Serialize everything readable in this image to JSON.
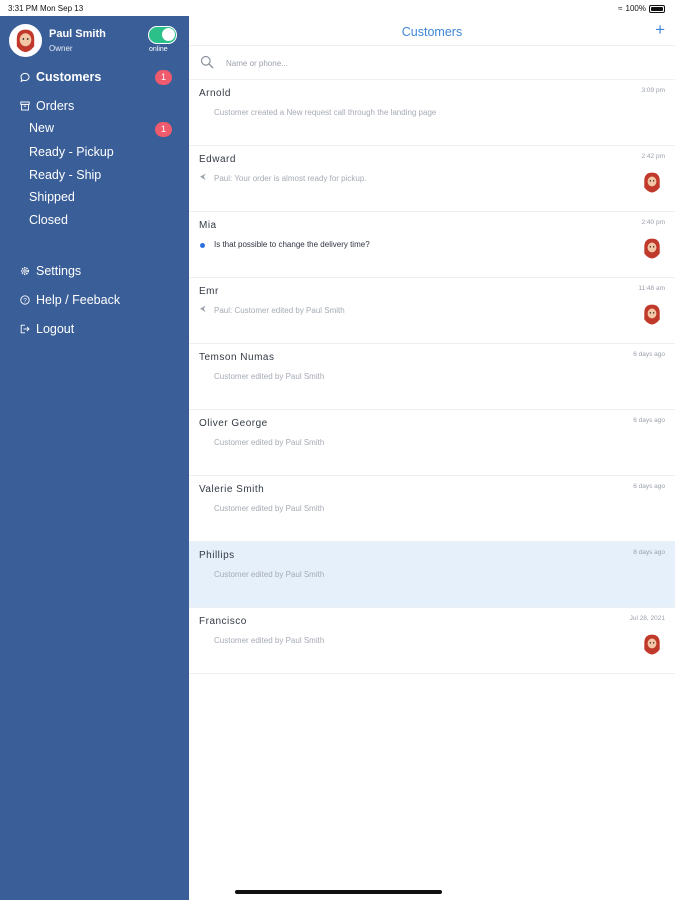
{
  "status_bar": {
    "time_date": "3:31 PM  Mon Sep 13",
    "battery": "100%"
  },
  "profile": {
    "name": "Paul Smith",
    "role": "Owner",
    "status": "online"
  },
  "nav": {
    "customers": {
      "label": "Customers",
      "badge": "1"
    },
    "orders": {
      "label": "Orders"
    },
    "order_subitems": [
      {
        "label": "New",
        "badge": "1"
      },
      {
        "label": "Ready - Pickup"
      },
      {
        "label": "Ready - Ship"
      },
      {
        "label": "Shipped"
      },
      {
        "label": "Closed"
      }
    ],
    "settings": {
      "label": "Settings"
    },
    "help": {
      "label": "Help / Feeback"
    },
    "logout": {
      "label": "Logout"
    }
  },
  "header": {
    "title": "Customers",
    "add_icon": "+"
  },
  "search": {
    "placeholder": "Name or phone..."
  },
  "customers": [
    {
      "name": "Arnold",
      "time": "3:09 pm",
      "message": "Customer created a New request call through the landing page",
      "marker": "none",
      "avatar": false,
      "selected": false
    },
    {
      "name": "Edward",
      "time": "2:42 pm",
      "message": "Paul: Your order is almost ready for pickup.",
      "marker": "reply",
      "avatar": true,
      "selected": false
    },
    {
      "name": "Mia",
      "time": "2:40 pm",
      "message": "Is that possible to change the delivery time?",
      "marker": "unread",
      "avatar": true,
      "selected": false
    },
    {
      "name": "Emr",
      "time": "11:48 am",
      "message": "Paul: Customer edited by Paul Smith",
      "marker": "reply",
      "avatar": true,
      "selected": false
    },
    {
      "name": "Temson Numas",
      "time": "6 days ago",
      "message": "Customer edited by Paul Smith",
      "marker": "none",
      "avatar": false,
      "selected": false
    },
    {
      "name": "Oliver George",
      "time": "6 days ago",
      "message": "Customer edited by Paul Smith",
      "marker": "none",
      "avatar": false,
      "selected": false
    },
    {
      "name": "Valerie Smith",
      "time": "6 days ago",
      "message": "Customer edited by Paul Smith",
      "marker": "none",
      "avatar": false,
      "selected": false
    },
    {
      "name": "Phillips",
      "time": "8 days ago",
      "message": "Customer edited by Paul Smith",
      "marker": "none",
      "avatar": false,
      "selected": true
    },
    {
      "name": "Francisco",
      "time": "Jul 28, 2021",
      "message": "Customer edited by Paul Smith",
      "marker": "none",
      "avatar": true,
      "selected": false
    }
  ],
  "colors": {
    "sidebar": "#3a5e98",
    "accent": "#3d86d8",
    "badge": "#ef5a6c",
    "toggle_on": "#2bbf8a",
    "selected_row": "#e6f0fb",
    "unread_dot": "#2f6fe0"
  }
}
